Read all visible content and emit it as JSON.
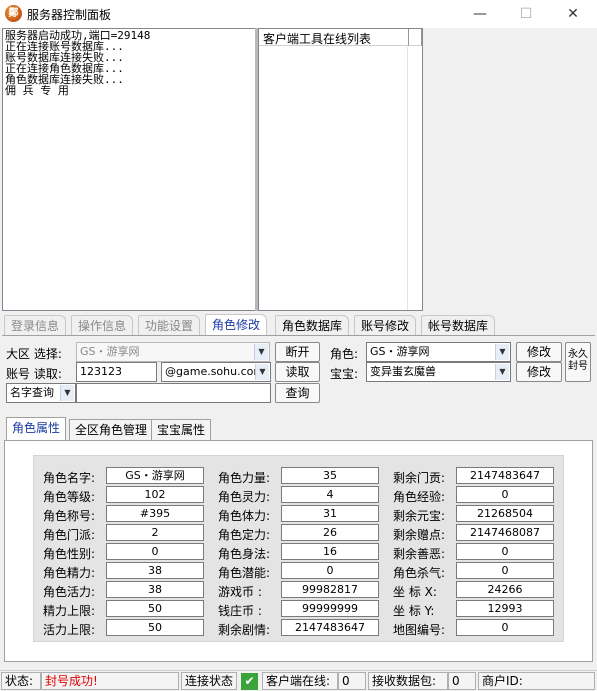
{
  "window": {
    "title": "服务器控制面板",
    "icon_text": "鄭",
    "min": "—",
    "max": "☐",
    "close": "✕"
  },
  "log": {
    "lines": "服务器启动成功,端口=29148\n正在连接账号数据库...\n账号数据库连接失败...\n正在连接角色数据库...\n角色数据库连接失败...\n佣 兵 专 用"
  },
  "client_list": {
    "header": "客户端工具在线列表"
  },
  "tabs": [
    "登录信息",
    "操作信息",
    "功能设置",
    "角色修改",
    "角色数据库",
    "账号修改",
    "帐号数据库"
  ],
  "form": {
    "region_label": "大区 选择:",
    "region_value": "GS・游享网",
    "disconnect_label": "断开",
    "account_label": "账号 读取:",
    "account_value": "123123",
    "domain_value": "@game.sohu.com",
    "read_label": "读取",
    "query_type_value": "名字查询",
    "query_label": "查询",
    "role_label": "角色:",
    "role_value": "GS・游享网",
    "pet_label": "宝宝:",
    "pet_value": "变异蚩玄魔兽",
    "modify1_label": "修改",
    "modify2_label": "修改",
    "ban_line1": "永久",
    "ban_line2": "封号"
  },
  "inner_tabs": [
    "角色属性",
    "全区角色管理",
    "宝宝属性"
  ],
  "attributes": {
    "col1": [
      {
        "label": "角色名字:",
        "value": "GS・游享网"
      },
      {
        "label": "角色等级:",
        "value": "102"
      },
      {
        "label": "角色称号:",
        "value": "#395"
      },
      {
        "label": "角色门派:",
        "value": "2"
      },
      {
        "label": "角色性别:",
        "value": "0"
      },
      {
        "label": "角色精力:",
        "value": "38"
      },
      {
        "label": "角色活力:",
        "value": "38"
      },
      {
        "label": "精力上限:",
        "value": "50"
      },
      {
        "label": "活力上限:",
        "value": "50"
      }
    ],
    "col2": [
      {
        "label": "角色力量:",
        "value": "35"
      },
      {
        "label": "角色灵力:",
        "value": "4"
      },
      {
        "label": "角色体力:",
        "value": "31"
      },
      {
        "label": "角色定力:",
        "value": "26"
      },
      {
        "label": "角色身法:",
        "value": "16"
      },
      {
        "label": "角色潜能:",
        "value": "0"
      },
      {
        "label": "游戏币  :",
        "value": "99982817"
      },
      {
        "label": "钱庄币  :",
        "value": "99999999"
      },
      {
        "label": "剩余剧情:",
        "value": "2147483647"
      }
    ],
    "col3": [
      {
        "label": "剩余门贡:",
        "value": "2147483647"
      },
      {
        "label": "角色经验:",
        "value": "0"
      },
      {
        "label": "剩余元宝:",
        "value": "21268504"
      },
      {
        "label": "剩余赠点:",
        "value": "2147468087"
      },
      {
        "label": "剩余善恶:",
        "value": "0"
      },
      {
        "label": "角色杀气:",
        "value": "0"
      },
      {
        "label": "坐  标  X:",
        "value": "24266"
      },
      {
        "label": "坐  标  Y:",
        "value": "12993"
      },
      {
        "label": "地图编号:",
        "value": "0"
      }
    ]
  },
  "status": {
    "status_label": "状态:",
    "status_value": "封号成功!",
    "connect_label": "连接状态",
    "connect_check": "✔",
    "online_label": "客户端在线:",
    "online_value": "0",
    "packets_label": "接收数据包:",
    "packets_value": "0",
    "merchant_label": "商户ID:",
    "merchant_value": ""
  },
  "colors": {
    "status_error": "#e00000",
    "active_tab": "#1a3aa0",
    "check_green": "#3aa43a"
  }
}
